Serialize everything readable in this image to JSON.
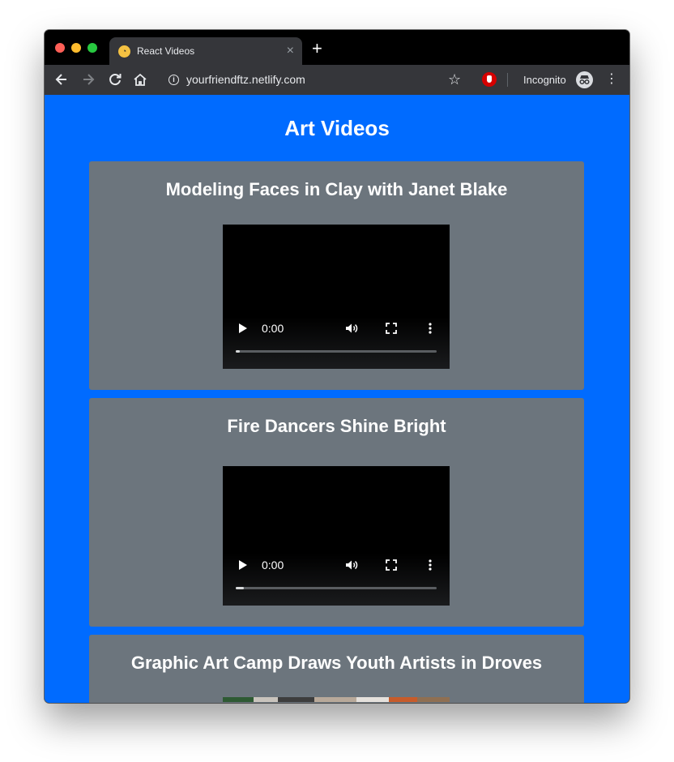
{
  "browser": {
    "tab_title": "React Videos",
    "close_glyph": "×",
    "new_tab_glyph": "+",
    "url": "yourfriendftz.netlify.com",
    "incognito_label": "Incognito",
    "icons": [
      "back-icon",
      "forward-icon",
      "reload-icon",
      "home-icon",
      "info-icon",
      "star-icon",
      "extension-icon",
      "incognito-icon",
      "kebab-menu-icon"
    ]
  },
  "page": {
    "title": "Art Videos",
    "colors": {
      "background": "#006bff",
      "card": "#6c757d"
    },
    "videos": [
      {
        "title": "Modeling Faces in Clay with Janet Blake",
        "time": "0:00",
        "progress": 0.02
      },
      {
        "title": "Fire Dancers Shine Bright",
        "time": "0:00",
        "progress": 0.04
      },
      {
        "title": "Graphic Art Camp Draws Youth Artists in Droves"
      }
    ]
  }
}
